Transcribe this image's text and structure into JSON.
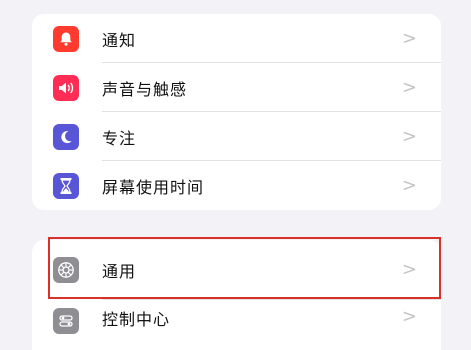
{
  "group1": {
    "items": [
      {
        "label": "通知",
        "icon": "bell-icon",
        "icon_color": "#ff3b30"
      },
      {
        "label": "声音与触感",
        "icon": "speaker-icon",
        "icon_color": "#ff2d55"
      },
      {
        "label": "专注",
        "icon": "moon-icon",
        "icon_color": "#5856d6"
      },
      {
        "label": "屏幕使用时间",
        "icon": "hourglass-icon",
        "icon_color": "#5856d6"
      }
    ]
  },
  "group2": {
    "items": [
      {
        "label": "通用",
        "icon": "gear-icon",
        "icon_color": "#8e8e93"
      },
      {
        "label": "控制中心",
        "icon": "control-center-icon",
        "icon_color": "#8e8e93"
      }
    ]
  },
  "chevron": ">",
  "highlight_color": "#d9302a"
}
